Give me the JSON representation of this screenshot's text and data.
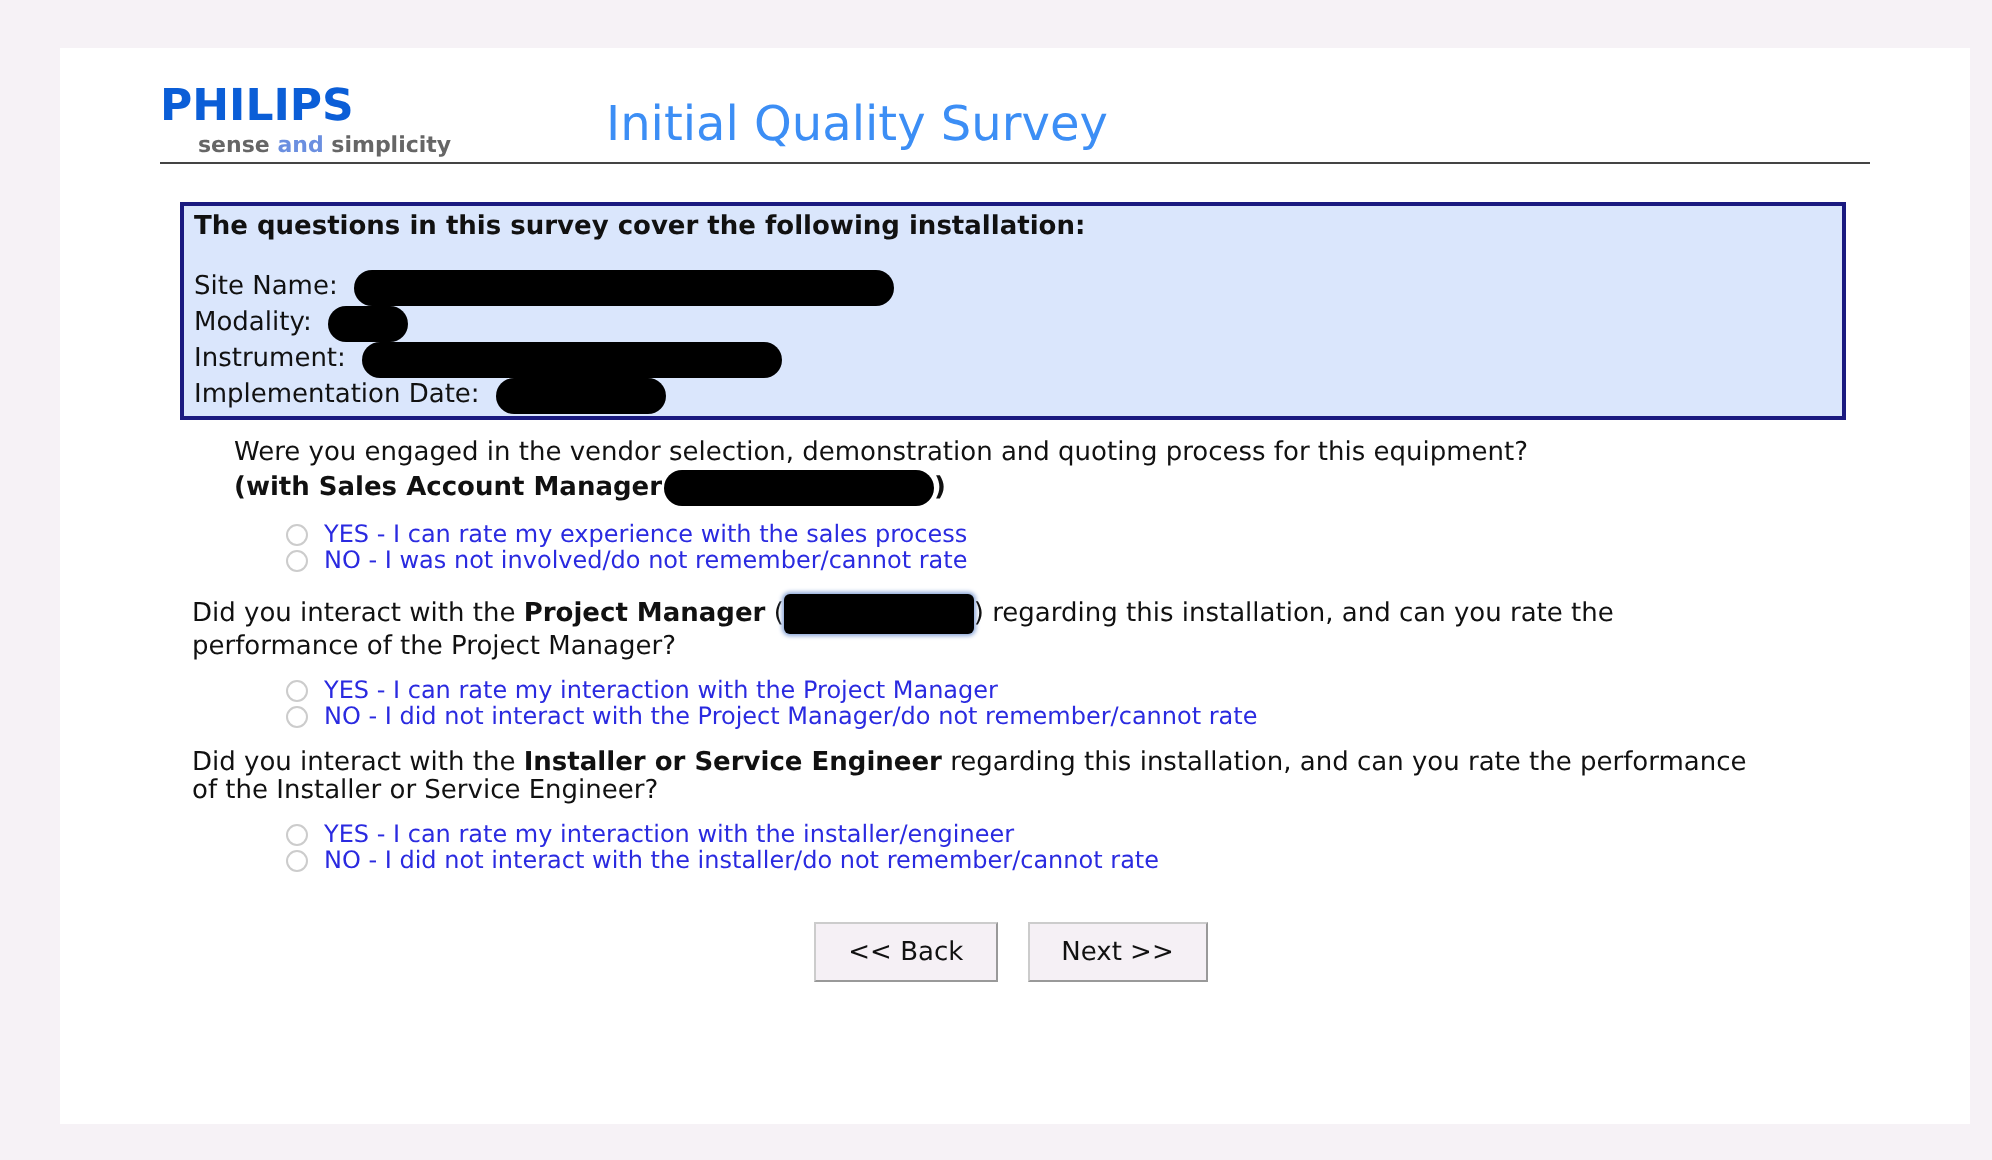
{
  "header": {
    "logo": "PHILIPS",
    "tagline_start": "sense",
    "tagline_mid": "and",
    "tagline_end": "simplicity",
    "title": "Initial Quality Survey"
  },
  "installation": {
    "heading": "The questions in this survey cover the following installation:",
    "fields": [
      {
        "label": "Site Name:",
        "redacted": true
      },
      {
        "label": "Modality:",
        "redacted": true
      },
      {
        "label": "Instrument:",
        "redacted": true
      },
      {
        "label": "Implementation Date:",
        "redacted": true
      }
    ]
  },
  "questions": [
    {
      "kind": "sales",
      "text": "Were you engaged in the vendor selection, demonstration and quoting process for this equipment?",
      "bold_line": "(with Sales Account Manager",
      "bold_end": ")",
      "options": [
        {
          "label": "YES - I can rate my experience with the sales process",
          "selected": false
        },
        {
          "label": "NO - I was not involved/do not remember/cannot rate",
          "selected": false
        }
      ]
    },
    {
      "kind": "inline",
      "text": "Did you interact with the **Project Manager** (",
      "text_end": ") regarding this installation, and can you rate the",
      "text_line2": "performance of the Project Manager?",
      "options": [
        {
          "label": "YES - I can rate my interaction with the Project Manager",
          "selected": false
        },
        {
          "label": "NO - I did not interact with the Project Manager/do not remember/cannot rate",
          "selected": false
        }
      ]
    },
    {
      "kind": "plain",
      "text": "Did you interact with the **Installer or Service Engineer** regarding this installation, and can you rate the performance of the Installer or Service Engineer?",
      "options": [
        {
          "label": "YES - I can rate my interaction with the installer/engineer",
          "selected": false
        },
        {
          "label": "NO - I did not interact with the installer/do not remember/cannot rate",
          "selected": false
        }
      ]
    }
  ],
  "buttons": [
    "<< Back",
    "Next >>"
  ]
}
